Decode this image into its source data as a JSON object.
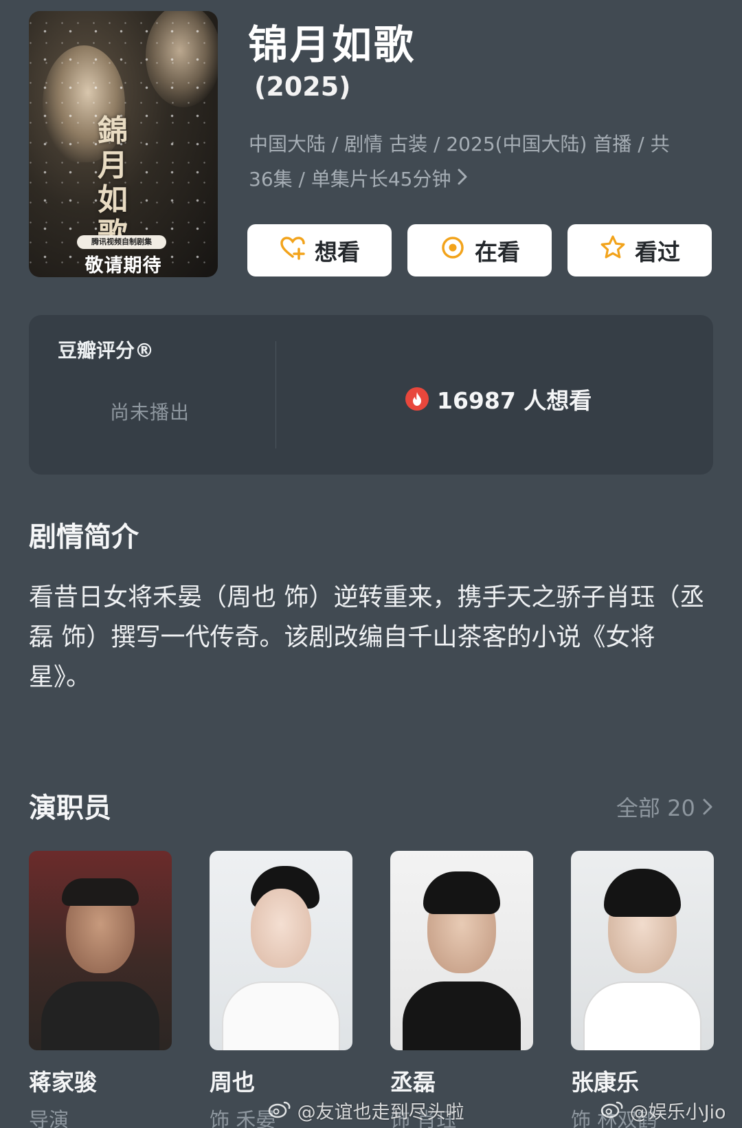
{
  "header": {
    "title": "锦月如歌",
    "year": "(2025)",
    "meta_line1": "中国大陆 / 剧情 古装 / 2025(中国大陆) 首播 / 共",
    "meta_line2": "36集 / 单集片长45分钟"
  },
  "poster": {
    "calligraphy": "錦月如歌",
    "tag": "腾讯视频自制剧集",
    "cta": "敬请期待"
  },
  "actions": [
    {
      "label": "想看",
      "icon": "heart-plus-icon"
    },
    {
      "label": "在看",
      "icon": "watching-circle-icon"
    },
    {
      "label": "看过",
      "icon": "star-outline-icon"
    }
  ],
  "rating": {
    "label": "豆瓣评分®",
    "status": "尚未播出",
    "want_count": "16987 人想看"
  },
  "synopsis": {
    "title": "剧情简介",
    "text": "看昔日女将禾晏（周也 饰）逆转重来，携手天之骄子肖珏（丞磊 饰）撰写一代传奇。该剧改编自千山茶客的小说《女将星》。"
  },
  "cast": {
    "title": "演职员",
    "more": "全部 20",
    "members": [
      {
        "name": "蒋家骏",
        "role": "导演"
      },
      {
        "name": "周也",
        "role": "饰 禾晏"
      },
      {
        "name": "丞磊",
        "role": "饰 肖珏"
      },
      {
        "name": "张康乐",
        "role": "饰 林双鹤"
      }
    ]
  },
  "watermarks": {
    "left": "@友谊也走到尽头啦",
    "right": "@娱乐小Jio"
  },
  "colors": {
    "background": "#414a52",
    "card": "#363e46",
    "accent_orange": "#f2a31b",
    "hot_red": "#e8473c"
  }
}
